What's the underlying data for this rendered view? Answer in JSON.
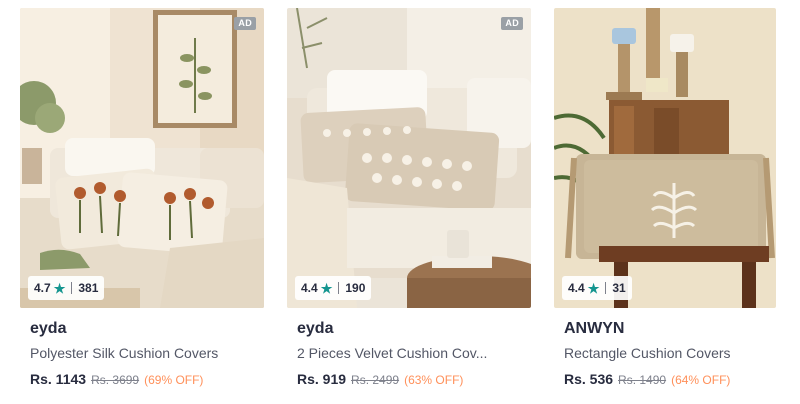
{
  "colors": {
    "rating_star": "#14958f",
    "discount": "#ff905a",
    "ad_badge": "#9aa0a6",
    "brand_text": "#282c3f",
    "name_text": "#535766",
    "mrp_text": "#7e818c"
  },
  "products": [
    {
      "ad_badge": "AD",
      "rating": "4.7",
      "rating_icon": "star-icon",
      "rating_count": "381",
      "brand": "eyda",
      "name": "Polyester Silk Cushion Covers",
      "price": "Rs. 1143",
      "mrp": "Rs. 3699",
      "discount": "(69% OFF)"
    },
    {
      "ad_badge": "AD",
      "rating": "4.4",
      "rating_icon": "star-icon",
      "rating_count": "190",
      "brand": "eyda",
      "name": "2 Pieces Velvet Cushion Cov...",
      "price": "Rs. 919",
      "mrp": "Rs. 2499",
      "discount": "(63% OFF)"
    },
    {
      "ad_badge": "",
      "rating": "4.4",
      "rating_icon": "star-icon",
      "rating_count": "31",
      "brand": "ANWYN",
      "name": "Rectangle Cushion Covers",
      "price": "Rs. 536",
      "mrp": "Rs. 1490",
      "discount": "(64% OFF)"
    }
  ]
}
